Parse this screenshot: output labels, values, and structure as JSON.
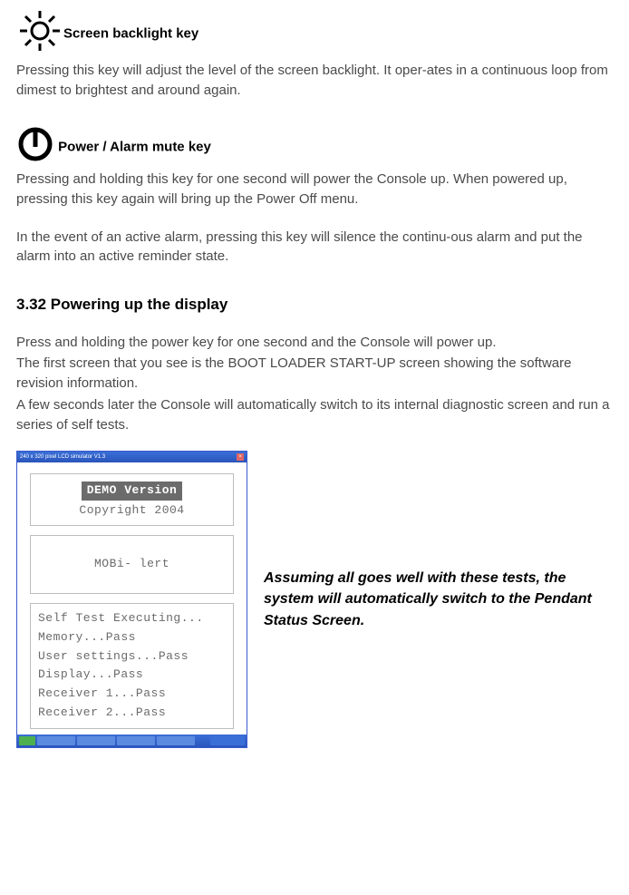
{
  "backlight": {
    "title": "Screen backlight key",
    "body": "Pressing this key   will adjust the level of the screen backlight. It oper-ates in a continuous loop from dimest to brightest and around again."
  },
  "power": {
    "title": " Power / Alarm mute key",
    "body1": "Pressing and holding this key for one second will power the Console up. When powered up, pressing this key again will bring up the Power Off menu.",
    "body2": "In the event of an active alarm, pressing this key will silence the continu-ous alarm and put the alarm into an active reminder state."
  },
  "section": {
    "heading": "3.32 Powering up the display",
    "p1": "Press and holding the power key  for one second and the Console will power up.",
    "p2": "The first screen that you see is the BOOT LOADER START-UP screen showing the software revision information.",
    "p3": "A few seconds later the Console will automatically switch to its internal diagnostic screen and run a series of self tests."
  },
  "lcd": {
    "title": "240 x 320 pixel LCD simulator V1.3",
    "demo": "DEMO Version",
    "copyright": "Copyright 2004",
    "product": "MOBi- lert",
    "tests": {
      "t0": "Self Test Executing...",
      "t1": " Memory...Pass",
      "t2": " User settings...Pass",
      "t3": " Display...Pass",
      "t4": " Receiver 1...Pass",
      "t5": " Receiver 2...Pass"
    }
  },
  "caption": "Assuming all goes well with these tests, the system will automatically switch to the Pendant Status Screen."
}
